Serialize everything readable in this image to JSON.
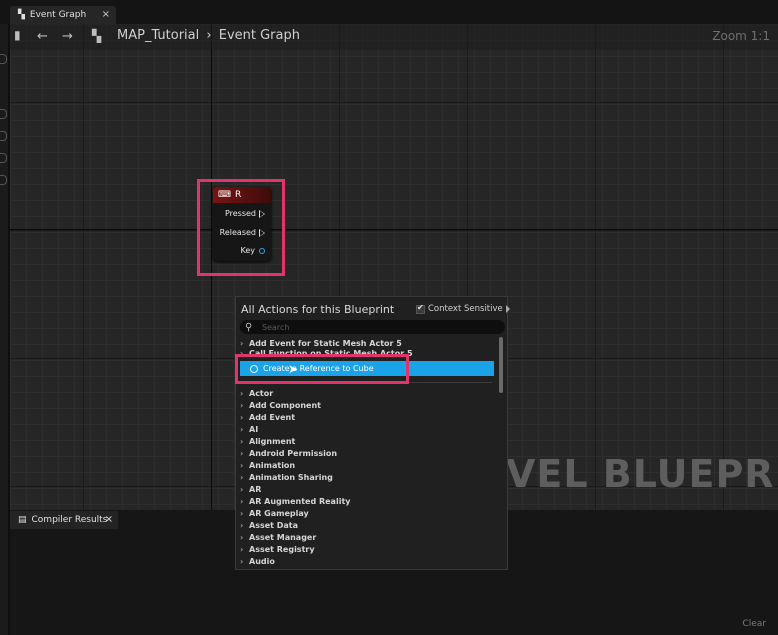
{
  "window": {
    "tab_label": "Event Graph",
    "tab_close": "×"
  },
  "toolbar": {
    "breadcrumb_root": "MAP_Tutorial",
    "breadcrumb_sep": "›",
    "breadcrumb_leaf": "Event Graph",
    "zoom": "Zoom 1:1"
  },
  "graph": {
    "watermark": "VEL BLUEPRINT"
  },
  "node": {
    "title": "R",
    "pins": [
      "Pressed",
      "Released",
      "Key"
    ]
  },
  "popup": {
    "title": "All Actions for this Blueprint",
    "context_sensitive_label": "Context Sensitive",
    "context_sensitive_checked": true,
    "search_placeholder": "Search",
    "top_items": [
      "Add Event for Static Mesh Actor 5",
      "Call Function on Static Mesh Actor 5"
    ],
    "selected_item": "Create a Reference to Cube",
    "categories": [
      "Actor",
      "Add Component",
      "Add Event",
      "AI",
      "Alignment",
      "Android Permission",
      "Animation",
      "Animation Sharing",
      "AR",
      "AR Augmented Reality",
      "AR Gameplay",
      "Asset Data",
      "Asset Manager",
      "Asset Registry",
      "Audio"
    ]
  },
  "bottom_panel": {
    "tab_label": "Compiler Results",
    "tab_close": "×",
    "clear_label": "Clear"
  },
  "colors": {
    "highlight": "#e0356b",
    "selection": "#1aa3e8",
    "node_header": "#7a1313"
  }
}
